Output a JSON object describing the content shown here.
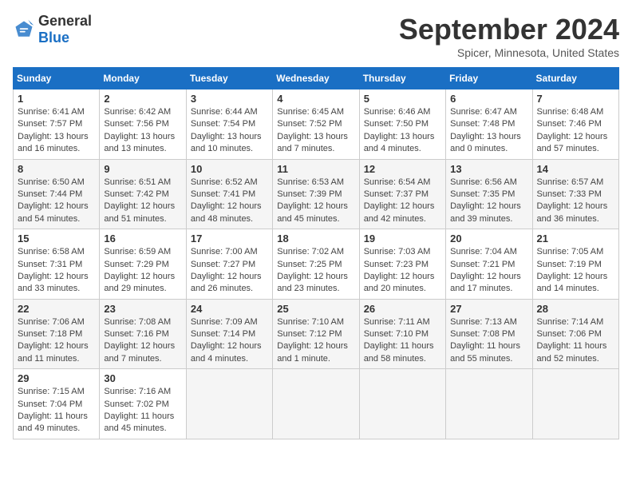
{
  "header": {
    "logo_general": "General",
    "logo_blue": "Blue",
    "month_title": "September 2024",
    "location": "Spicer, Minnesota, United States"
  },
  "weekdays": [
    "Sunday",
    "Monday",
    "Tuesday",
    "Wednesday",
    "Thursday",
    "Friday",
    "Saturday"
  ],
  "weeks": [
    [
      {
        "day": "1",
        "sunrise": "Sunrise: 6:41 AM",
        "sunset": "Sunset: 7:57 PM",
        "daylight": "Daylight: 13 hours and 16 minutes."
      },
      {
        "day": "2",
        "sunrise": "Sunrise: 6:42 AM",
        "sunset": "Sunset: 7:56 PM",
        "daylight": "Daylight: 13 hours and 13 minutes."
      },
      {
        "day": "3",
        "sunrise": "Sunrise: 6:44 AM",
        "sunset": "Sunset: 7:54 PM",
        "daylight": "Daylight: 13 hours and 10 minutes."
      },
      {
        "day": "4",
        "sunrise": "Sunrise: 6:45 AM",
        "sunset": "Sunset: 7:52 PM",
        "daylight": "Daylight: 13 hours and 7 minutes."
      },
      {
        "day": "5",
        "sunrise": "Sunrise: 6:46 AM",
        "sunset": "Sunset: 7:50 PM",
        "daylight": "Daylight: 13 hours and 4 minutes."
      },
      {
        "day": "6",
        "sunrise": "Sunrise: 6:47 AM",
        "sunset": "Sunset: 7:48 PM",
        "daylight": "Daylight: 13 hours and 0 minutes."
      },
      {
        "day": "7",
        "sunrise": "Sunrise: 6:48 AM",
        "sunset": "Sunset: 7:46 PM",
        "daylight": "Daylight: 12 hours and 57 minutes."
      }
    ],
    [
      {
        "day": "8",
        "sunrise": "Sunrise: 6:50 AM",
        "sunset": "Sunset: 7:44 PM",
        "daylight": "Daylight: 12 hours and 54 minutes."
      },
      {
        "day": "9",
        "sunrise": "Sunrise: 6:51 AM",
        "sunset": "Sunset: 7:42 PM",
        "daylight": "Daylight: 12 hours and 51 minutes."
      },
      {
        "day": "10",
        "sunrise": "Sunrise: 6:52 AM",
        "sunset": "Sunset: 7:41 PM",
        "daylight": "Daylight: 12 hours and 48 minutes."
      },
      {
        "day": "11",
        "sunrise": "Sunrise: 6:53 AM",
        "sunset": "Sunset: 7:39 PM",
        "daylight": "Daylight: 12 hours and 45 minutes."
      },
      {
        "day": "12",
        "sunrise": "Sunrise: 6:54 AM",
        "sunset": "Sunset: 7:37 PM",
        "daylight": "Daylight: 12 hours and 42 minutes."
      },
      {
        "day": "13",
        "sunrise": "Sunrise: 6:56 AM",
        "sunset": "Sunset: 7:35 PM",
        "daylight": "Daylight: 12 hours and 39 minutes."
      },
      {
        "day": "14",
        "sunrise": "Sunrise: 6:57 AM",
        "sunset": "Sunset: 7:33 PM",
        "daylight": "Daylight: 12 hours and 36 minutes."
      }
    ],
    [
      {
        "day": "15",
        "sunrise": "Sunrise: 6:58 AM",
        "sunset": "Sunset: 7:31 PM",
        "daylight": "Daylight: 12 hours and 33 minutes."
      },
      {
        "day": "16",
        "sunrise": "Sunrise: 6:59 AM",
        "sunset": "Sunset: 7:29 PM",
        "daylight": "Daylight: 12 hours and 29 minutes."
      },
      {
        "day": "17",
        "sunrise": "Sunrise: 7:00 AM",
        "sunset": "Sunset: 7:27 PM",
        "daylight": "Daylight: 12 hours and 26 minutes."
      },
      {
        "day": "18",
        "sunrise": "Sunrise: 7:02 AM",
        "sunset": "Sunset: 7:25 PM",
        "daylight": "Daylight: 12 hours and 23 minutes."
      },
      {
        "day": "19",
        "sunrise": "Sunrise: 7:03 AM",
        "sunset": "Sunset: 7:23 PM",
        "daylight": "Daylight: 12 hours and 20 minutes."
      },
      {
        "day": "20",
        "sunrise": "Sunrise: 7:04 AM",
        "sunset": "Sunset: 7:21 PM",
        "daylight": "Daylight: 12 hours and 17 minutes."
      },
      {
        "day": "21",
        "sunrise": "Sunrise: 7:05 AM",
        "sunset": "Sunset: 7:19 PM",
        "daylight": "Daylight: 12 hours and 14 minutes."
      }
    ],
    [
      {
        "day": "22",
        "sunrise": "Sunrise: 7:06 AM",
        "sunset": "Sunset: 7:18 PM",
        "daylight": "Daylight: 12 hours and 11 minutes."
      },
      {
        "day": "23",
        "sunrise": "Sunrise: 7:08 AM",
        "sunset": "Sunset: 7:16 PM",
        "daylight": "Daylight: 12 hours and 7 minutes."
      },
      {
        "day": "24",
        "sunrise": "Sunrise: 7:09 AM",
        "sunset": "Sunset: 7:14 PM",
        "daylight": "Daylight: 12 hours and 4 minutes."
      },
      {
        "day": "25",
        "sunrise": "Sunrise: 7:10 AM",
        "sunset": "Sunset: 7:12 PM",
        "daylight": "Daylight: 12 hours and 1 minute."
      },
      {
        "day": "26",
        "sunrise": "Sunrise: 7:11 AM",
        "sunset": "Sunset: 7:10 PM",
        "daylight": "Daylight: 11 hours and 58 minutes."
      },
      {
        "day": "27",
        "sunrise": "Sunrise: 7:13 AM",
        "sunset": "Sunset: 7:08 PM",
        "daylight": "Daylight: 11 hours and 55 minutes."
      },
      {
        "day": "28",
        "sunrise": "Sunrise: 7:14 AM",
        "sunset": "Sunset: 7:06 PM",
        "daylight": "Daylight: 11 hours and 52 minutes."
      }
    ],
    [
      {
        "day": "29",
        "sunrise": "Sunrise: 7:15 AM",
        "sunset": "Sunset: 7:04 PM",
        "daylight": "Daylight: 11 hours and 49 minutes."
      },
      {
        "day": "30",
        "sunrise": "Sunrise: 7:16 AM",
        "sunset": "Sunset: 7:02 PM",
        "daylight": "Daylight: 11 hours and 45 minutes."
      },
      null,
      null,
      null,
      null,
      null
    ]
  ]
}
